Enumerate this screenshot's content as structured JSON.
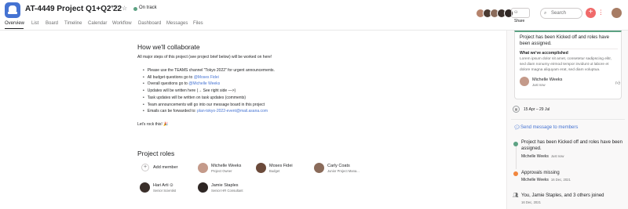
{
  "header": {
    "project_title": "AT-4449 Project Q1+Q2'22",
    "status": "On track",
    "share_label": "Share",
    "search_placeholder": "Search",
    "plus_label": "+",
    "colors": {
      "brand": "#4573d2",
      "status": "#5da283",
      "accent": "#f06a6a"
    }
  },
  "tabs": [
    "Overview",
    "List",
    "Board",
    "Timeline",
    "Calendar",
    "Workflow",
    "Dashboard",
    "Messages",
    "Files"
  ],
  "collaborate": {
    "title": "How we'll collaborate",
    "intro": "All major steps of this project (see project brief below) will be worked on here!",
    "bullets": [
      {
        "text": "Please use the TEAMS channel \"Tokyo 2022\" for urgent announcements.",
        "link": ""
      },
      {
        "text": "All budget questions go to ",
        "link": "@Moses Fidei"
      },
      {
        "text": "Overall questions go to ",
        "link": "@Michelle Weeks"
      },
      {
        "text": "Updates will be written here (→ See right side —>)",
        "link": ""
      },
      {
        "text": "Task updates will be written on task updates (comments)",
        "link": ""
      },
      {
        "text": "Team announcements will go into our message board in this project",
        "link": ""
      },
      {
        "text": "Emails can be forwarded to: ",
        "link": "plan-tokyo-2022-event@mail.asana.com"
      }
    ],
    "closing": "Let's rock this! 🎉"
  },
  "roles": {
    "title": "Project roles",
    "add_member": "Add member",
    "members": [
      {
        "name": "Michelle Weeks",
        "role": "Project Owner",
        "color": "#c49a8a"
      },
      {
        "name": "Moses Fidei",
        "role": "Budget",
        "color": "#6b4a3a"
      },
      {
        "name": "Carly Coats",
        "role": "Junior Project Mana...",
        "color": "#8a6b5a"
      },
      {
        "name": "Hari Arti ⊙",
        "role": "Senior Scientist",
        "color": "#3a2f2a"
      },
      {
        "name": "Jamie Staples",
        "role": "Senior HR Consultant",
        "color": "#2e2624"
      }
    ]
  },
  "right_panel": {
    "card": {
      "title": "Project has been Kicked off and roles have been assigned.",
      "subtitle": "What we've accomplished",
      "body": "Lorem ipsum dolor sit amet, consetetur sadipscing elitr, sed diam nonumy eirmod tempor invidunt ut labore et dolore magna aliquyam erat, sed diam voluptua.",
      "author": "Michelle Weeks",
      "time": "Just now"
    },
    "dates": "15 Apr – 29 Jul",
    "send_message": "Send message to members",
    "events": [
      {
        "title": "Project has been Kicked off and roles have been assigned.",
        "author": "Michelle Weeks",
        "date": "Just now",
        "color": "#5da283"
      },
      {
        "title": "Approvals missing",
        "author": "Michelle Weeks",
        "date": "16 Dec, 2021",
        "color": "#f1863d"
      },
      {
        "title": "You, Jamie Staples, and 3 others joined",
        "author": "",
        "date": "16 Dec, 2021",
        "color": ""
      }
    ]
  }
}
